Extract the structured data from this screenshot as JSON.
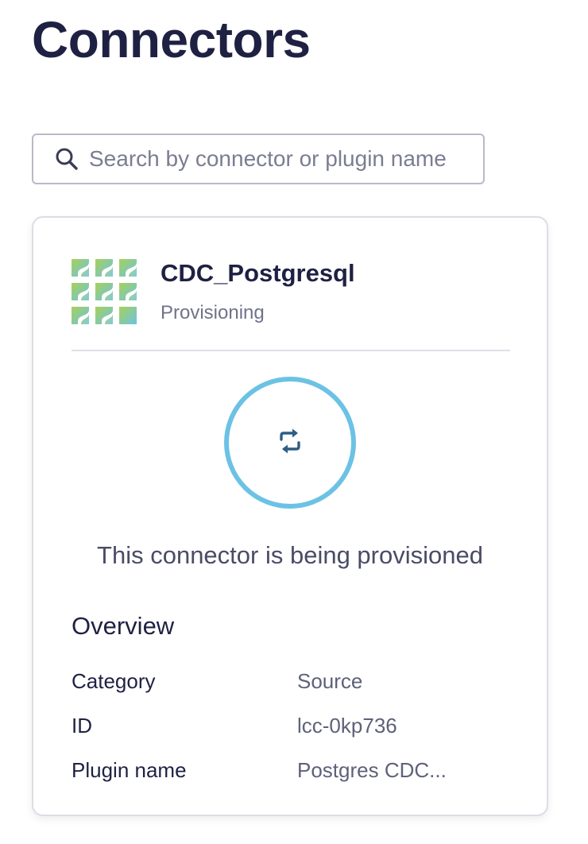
{
  "page": {
    "title": "Connectors"
  },
  "search": {
    "placeholder": "Search by connector or plugin name",
    "icon": "search-icon"
  },
  "connector": {
    "name": "CDC_Postgresql",
    "status": "Provisioning",
    "logo": "connector-logo-icon",
    "provisioning_icon": "sync-arrows-icon",
    "provisioning_message": "This connector is being provisioned",
    "overview": {
      "title": "Overview",
      "rows": [
        {
          "label": "Category",
          "value": "Source"
        },
        {
          "label": "ID",
          "value": "lcc-0kp736"
        },
        {
          "label": "Plugin name",
          "value": "Postgres CDC..."
        }
      ]
    }
  },
  "colors": {
    "title_text": "#1f2143",
    "ring": "#6cc2e4",
    "sync_icon": "#2f5d83",
    "logo_start": "#a7d157",
    "logo_end": "#6cc2e4"
  }
}
